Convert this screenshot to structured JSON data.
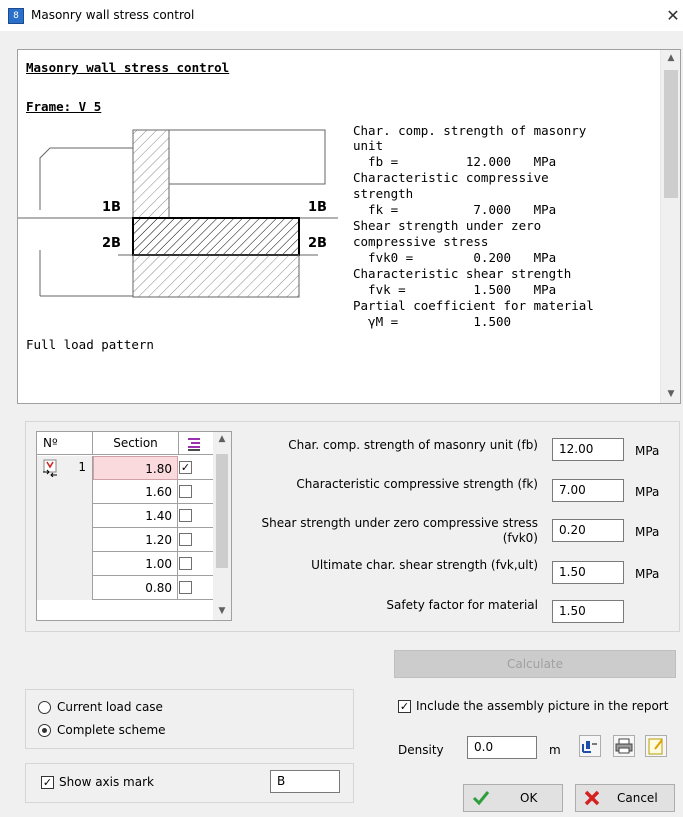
{
  "window": {
    "title": "Masonry wall stress control",
    "close": "✕",
    "icon_glyph": "8"
  },
  "report": {
    "heading": "Masonry wall stress control",
    "frame": "Frame: V 5",
    "label_1B_left": "1B",
    "label_1B_right": "1B",
    "label_2B_left": "2B",
    "label_2B_right": "2B",
    "lines": [
      "Char. comp. strength of masonry",
      "unit",
      "  fb =         12.000   MPa",
      "Characteristic compressive",
      "strength",
      "  fk =          7.000   MPa",
      "Shear strength under zero",
      "compressive stress",
      "  fvk0 =        0.200   MPa",
      "Characteristic shear strength",
      "  fvk =         1.500   MPa",
      "Partial coefficient for material",
      "  γM =          1.500"
    ],
    "footer": "Full load pattern"
  },
  "table": {
    "col_no": "Nº",
    "col_section": "Section",
    "rows": [
      {
        "no": "1",
        "section": "1.80",
        "checked": "✓"
      },
      {
        "no": "",
        "section": "1.60",
        "checked": ""
      },
      {
        "no": "",
        "section": "1.40",
        "checked": ""
      },
      {
        "no": "",
        "section": "1.20",
        "checked": ""
      },
      {
        "no": "",
        "section": "1.00",
        "checked": ""
      },
      {
        "no": "",
        "section": "0.80",
        "checked": ""
      }
    ]
  },
  "params": {
    "fb_label": "Char. comp. strength of masonry unit (fb)",
    "fb_value": "12.00",
    "fk_label": "Characteristic compressive strength (fk)",
    "fk_value": "7.00",
    "fvk0_label_1": "Shear strength under zero compressive stress",
    "fvk0_label_2": "(fvk0)",
    "fvk0_value": "0.20",
    "fvk_label": "Ultimate char. shear strength (fvk,ult)",
    "fvk_value": "1.50",
    "gm_label": "Safety factor for material",
    "gm_value": "1.50",
    "unit": "MPa"
  },
  "calculate_label": "Calculate",
  "options": {
    "current_load_case": "Current load case",
    "complete_scheme": "Complete scheme",
    "show_axis_mark": "Show axis mark",
    "axis_mark_value": "B",
    "include_picture": "Include the assembly picture in the report",
    "density_label": "Density",
    "density_value": "0.0",
    "density_unit": "m"
  },
  "buttons": {
    "ok": "OK",
    "cancel": "Cancel"
  },
  "colors": {
    "accent_blue": "#0078d7",
    "selected_cell": "#fadadd",
    "ok_green": "#2e9e3a",
    "cancel_red": "#d52020"
  }
}
